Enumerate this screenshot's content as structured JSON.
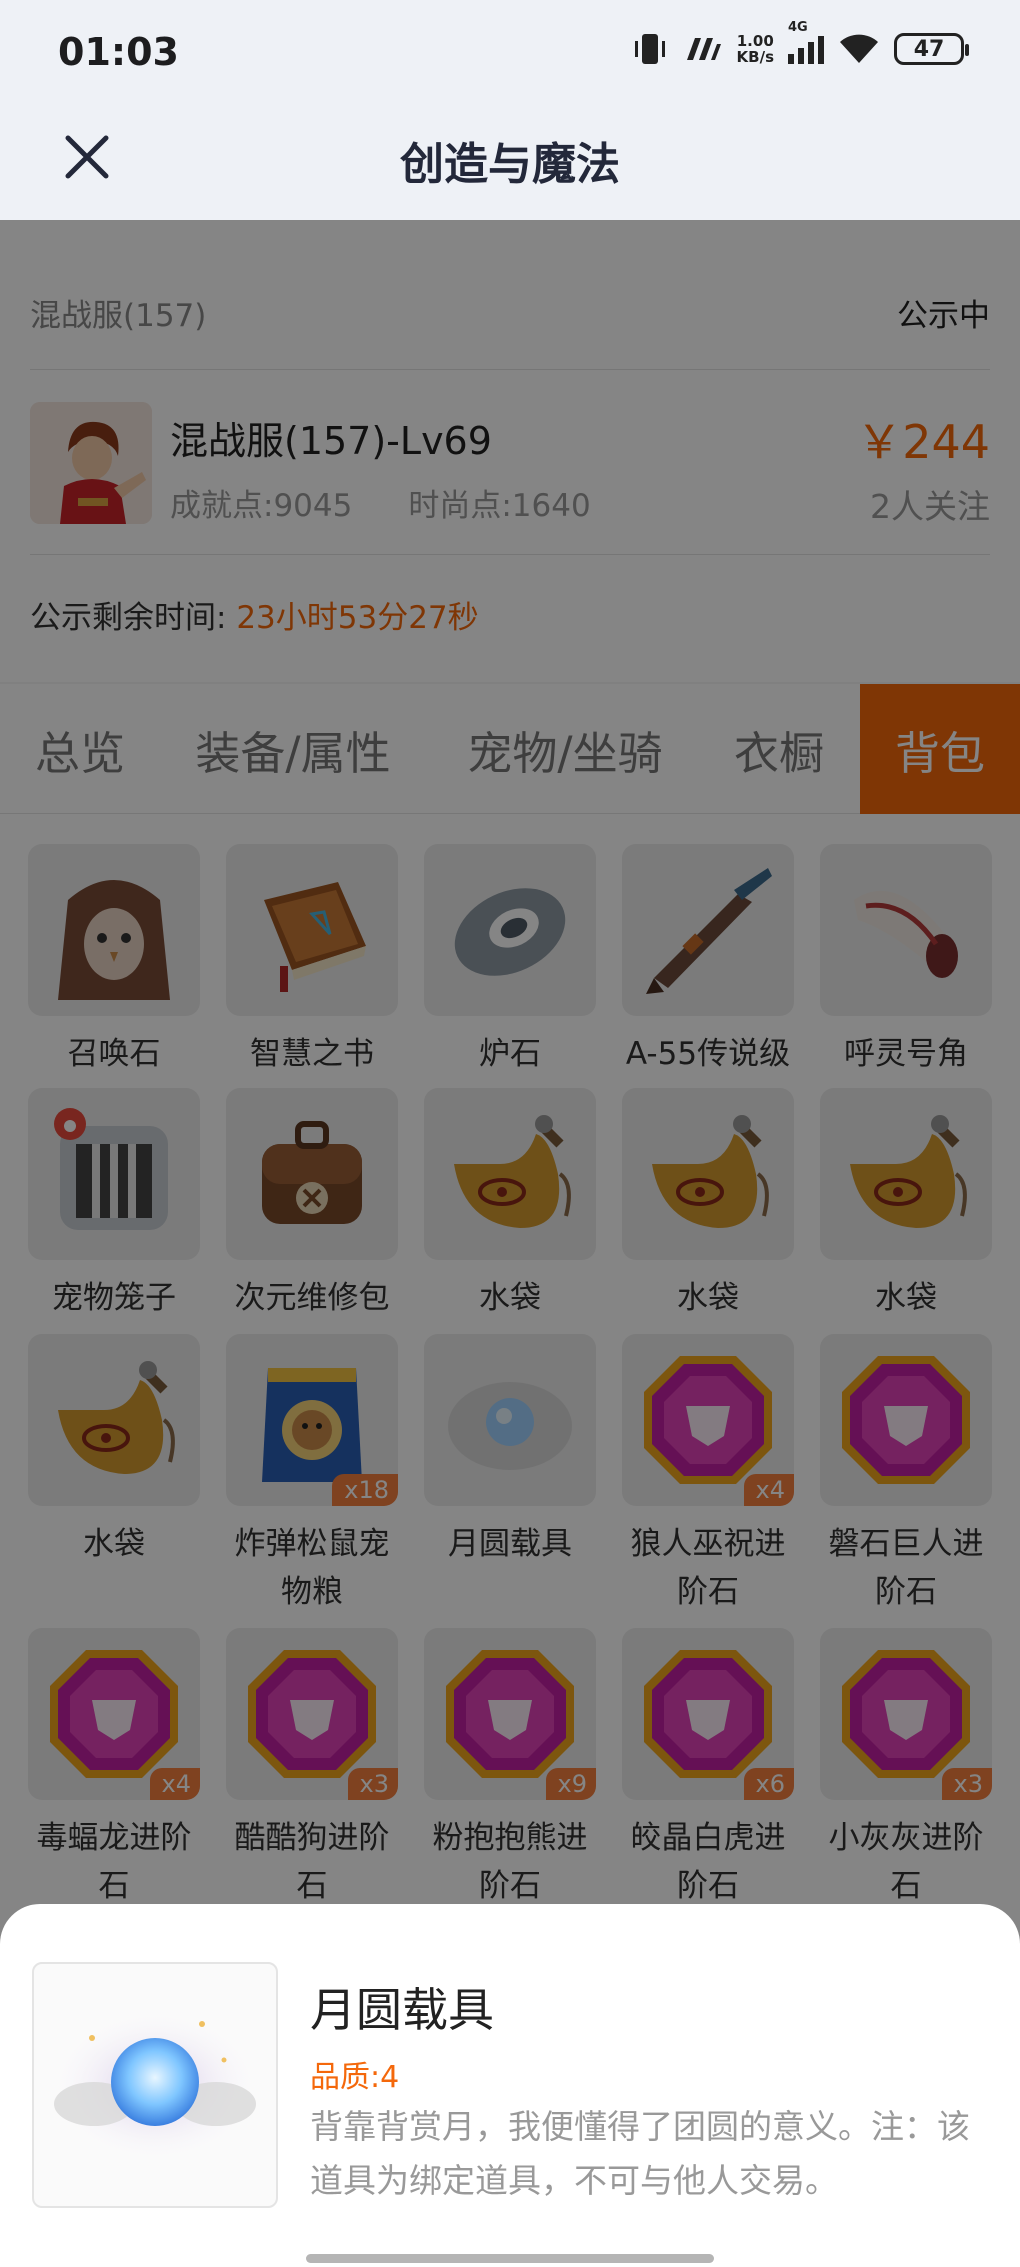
{
  "status_bar": {
    "time": "01:03",
    "net_speed": "1.00",
    "net_unit": "KB/s",
    "network_type": "4G",
    "battery": "47"
  },
  "nav": {
    "title": "创造与魔法",
    "close_icon": "close-icon"
  },
  "listing": {
    "server": "混战服(157)",
    "status": "公示中",
    "role_name": "混战服(157)-Lv69",
    "achievement": "成就点:9045",
    "fashion": "时尚点:1640",
    "price": "￥244",
    "followers": "2人关注",
    "countdown_label": "公示剩余时间:",
    "countdown_value": "23小时53分27秒"
  },
  "tabs": [
    {
      "label": "总览",
      "active": false
    },
    {
      "label": "装备/属性",
      "active": false
    },
    {
      "label": "宠物/坐骑",
      "active": false
    },
    {
      "label": "衣橱",
      "active": false
    },
    {
      "label": "背包",
      "active": true
    }
  ],
  "items": [
    {
      "name": "召唤石",
      "icon": "owl-hood-icon"
    },
    {
      "name": "智慧之书",
      "icon": "book-icon"
    },
    {
      "name": "炉石",
      "icon": "hearthstone-icon"
    },
    {
      "name": "A-55传说级",
      "icon": "rifle-icon"
    },
    {
      "name": "呼灵号角",
      "icon": "horn-icon"
    },
    {
      "name": "宠物笼子",
      "icon": "pet-cage-icon"
    },
    {
      "name": "次元维修包",
      "icon": "repair-bag-icon"
    },
    {
      "name": "水袋",
      "icon": "water-bag-icon"
    },
    {
      "name": "水袋",
      "icon": "water-bag-icon"
    },
    {
      "name": "水袋",
      "icon": "water-bag-icon"
    },
    {
      "name": "水袋",
      "icon": "water-bag-icon"
    },
    {
      "name": "炸弹松鼠宠物粮",
      "icon": "pet-food-icon",
      "qty": "x18"
    },
    {
      "name": "月圆载具",
      "icon": "moon-orb-icon"
    },
    {
      "name": "狼人巫祝进阶石",
      "icon": "gem-icon",
      "qty": "x4"
    },
    {
      "name": "磐石巨人进阶石",
      "icon": "gem-icon"
    },
    {
      "name": "毒蝠龙进阶石",
      "icon": "gem-icon",
      "qty": "x4"
    },
    {
      "name": "酷酷狗进阶石",
      "icon": "gem-icon",
      "qty": "x3"
    },
    {
      "name": "粉抱抱熊进阶石",
      "icon": "gem-icon",
      "qty": "x9"
    },
    {
      "name": "皎晶白虎进阶石",
      "icon": "gem-icon",
      "qty": "x6"
    },
    {
      "name": "小灰灰进阶石",
      "icon": "gem-icon",
      "qty": "x3"
    }
  ],
  "item_label_lines": [
    [
      "召唤石"
    ],
    [
      "智慧之书"
    ],
    [
      "炉石"
    ],
    [
      "A-55传说级"
    ],
    [
      "呼灵号角"
    ],
    [
      "宠物笼子"
    ],
    [
      "次元维修包"
    ],
    [
      "水袋"
    ],
    [
      "水袋"
    ],
    [
      "水袋"
    ],
    [
      "水袋"
    ],
    [
      "炸弹松鼠宠",
      "物粮"
    ],
    [
      "月圆载具"
    ],
    [
      "狼人巫祝进",
      "阶石"
    ],
    [
      "磐石巨人进",
      "阶石"
    ],
    [
      "毒蝠龙进阶",
      "石"
    ],
    [
      "酷酷狗进阶",
      "石"
    ],
    [
      "粉抱抱熊进",
      "阶石"
    ],
    [
      "皎晶白虎进",
      "阶石"
    ],
    [
      "小灰灰进阶",
      "石"
    ]
  ],
  "detail": {
    "title": "月圆载具",
    "quality": "品质:4",
    "description": "背靠背赏月，我便懂得了团圆的意义。注：该道具为绑定道具，不可与他人交易。",
    "image_icon": "moon-orb-icon"
  },
  "colors": {
    "accent": "#f4680b",
    "badge": "#f37f3e",
    "header_bg": "#eef1f6"
  }
}
